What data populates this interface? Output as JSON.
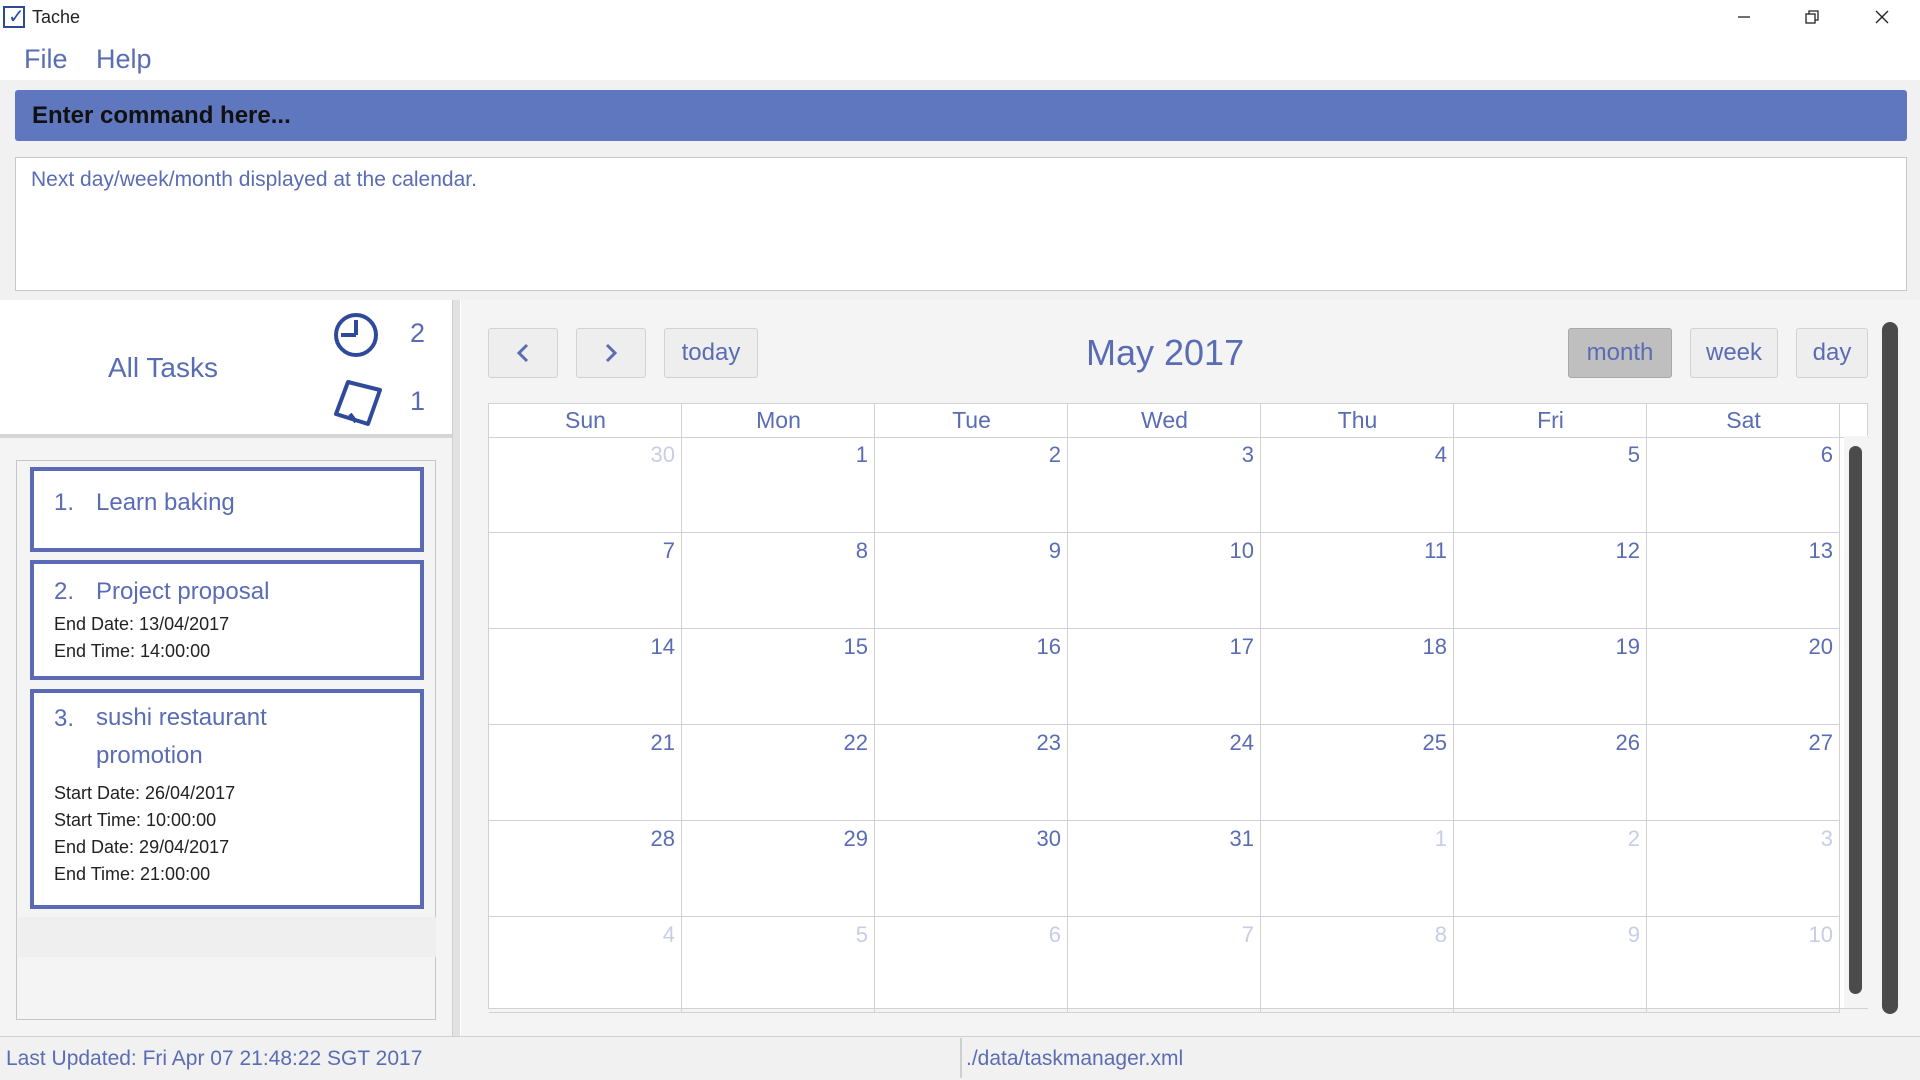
{
  "window": {
    "title": "Tache"
  },
  "menu": {
    "file": "File",
    "help": "Help"
  },
  "command": {
    "placeholder": "Enter command here..."
  },
  "result": {
    "text": "Next day/week/month displayed at the calendar."
  },
  "tasks_panel": {
    "title": "All Tasks",
    "deadline_count": "2",
    "floating_count": "1",
    "tasks": [
      {
        "index": "1.",
        "name": "Learn baking",
        "details": []
      },
      {
        "index": "2.",
        "name": "Project proposal",
        "details": [
          "End Date: 13/04/2017",
          "End Time: 14:00:00"
        ]
      },
      {
        "index": "3.",
        "name": "sushi restaurant promotion",
        "details": [
          "Start Date: 26/04/2017",
          "Start Time: 10:00:00",
          "End Date: 29/04/2017",
          "End Time: 21:00:00"
        ]
      }
    ]
  },
  "calendar": {
    "title": "May 2017",
    "buttons": {
      "prev": "<",
      "next": ">",
      "today": "today",
      "month": "month",
      "week": "week",
      "day": "day"
    },
    "active_view": "month",
    "days_of_week": [
      "Sun",
      "Mon",
      "Tue",
      "Wed",
      "Thu",
      "Fri",
      "Sat"
    ],
    "weeks": [
      [
        {
          "d": "30",
          "o": true
        },
        {
          "d": "1"
        },
        {
          "d": "2"
        },
        {
          "d": "3"
        },
        {
          "d": "4"
        },
        {
          "d": "5"
        },
        {
          "d": "6"
        }
      ],
      [
        {
          "d": "7"
        },
        {
          "d": "8"
        },
        {
          "d": "9"
        },
        {
          "d": "10"
        },
        {
          "d": "11"
        },
        {
          "d": "12"
        },
        {
          "d": "13"
        }
      ],
      [
        {
          "d": "14"
        },
        {
          "d": "15"
        },
        {
          "d": "16"
        },
        {
          "d": "17"
        },
        {
          "d": "18"
        },
        {
          "d": "19"
        },
        {
          "d": "20"
        }
      ],
      [
        {
          "d": "21"
        },
        {
          "d": "22"
        },
        {
          "d": "23"
        },
        {
          "d": "24"
        },
        {
          "d": "25"
        },
        {
          "d": "26"
        },
        {
          "d": "27"
        }
      ],
      [
        {
          "d": "28"
        },
        {
          "d": "29"
        },
        {
          "d": "30"
        },
        {
          "d": "31"
        },
        {
          "d": "1",
          "o": true
        },
        {
          "d": "2",
          "o": true
        },
        {
          "d": "3",
          "o": true
        }
      ],
      [
        {
          "d": "4",
          "o": true
        },
        {
          "d": "5",
          "o": true
        },
        {
          "d": "6",
          "o": true
        },
        {
          "d": "7",
          "o": true
        },
        {
          "d": "8",
          "o": true
        },
        {
          "d": "9",
          "o": true
        },
        {
          "d": "10",
          "o": true
        }
      ]
    ]
  },
  "status": {
    "last_updated": "Last Updated: Fri Apr 07 21:48:22 SGT 2017",
    "file_path": "./data/taskmanager.xml"
  },
  "colors": {
    "accent": "#5a6cb4",
    "command_bar": "#5f77be",
    "card_border": "#5b6ab5"
  },
  "icons": {
    "deadline": "clock-icon",
    "floating": "note-icon"
  }
}
